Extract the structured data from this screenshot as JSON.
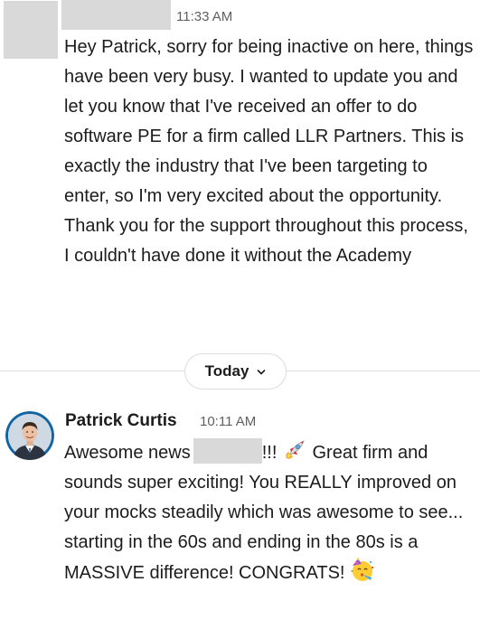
{
  "message_1": {
    "timestamp": "11:33 AM",
    "body": "Hey Patrick, sorry for being inactive on here, things have been very busy. I wanted to update you and let you know that I've received an offer to do software PE for a firm called LLR Partners. This is exactly the industry that I've been targeting to enter, so I'm very excited about the opportunity. Thank you for the support throughout this process, I couldn't have done it without the Academy"
  },
  "day_divider": {
    "label": "Today",
    "icon": "chevron-down-icon"
  },
  "message_2": {
    "author": "Patrick Curtis",
    "timestamp": "10:11 AM",
    "text_part_1": "Awesome news",
    "text_part_2": "!!!",
    "emoji_1": "rocket-emoji",
    "text_part_3": "Great firm and sounds super exciting!  You REALLY improved on your mocks steadily which was awesome to see...  starting in the 60s and ending in the 80s is a MASSIVE difference! CONGRATS!",
    "emoji_2": "partying-face-emoji"
  },
  "colors": {
    "text": "#1d1c1d",
    "muted": "#616061",
    "redaction": "#d9d9d9",
    "divider": "#dddddd",
    "avatar_ring": "#1264a3"
  }
}
